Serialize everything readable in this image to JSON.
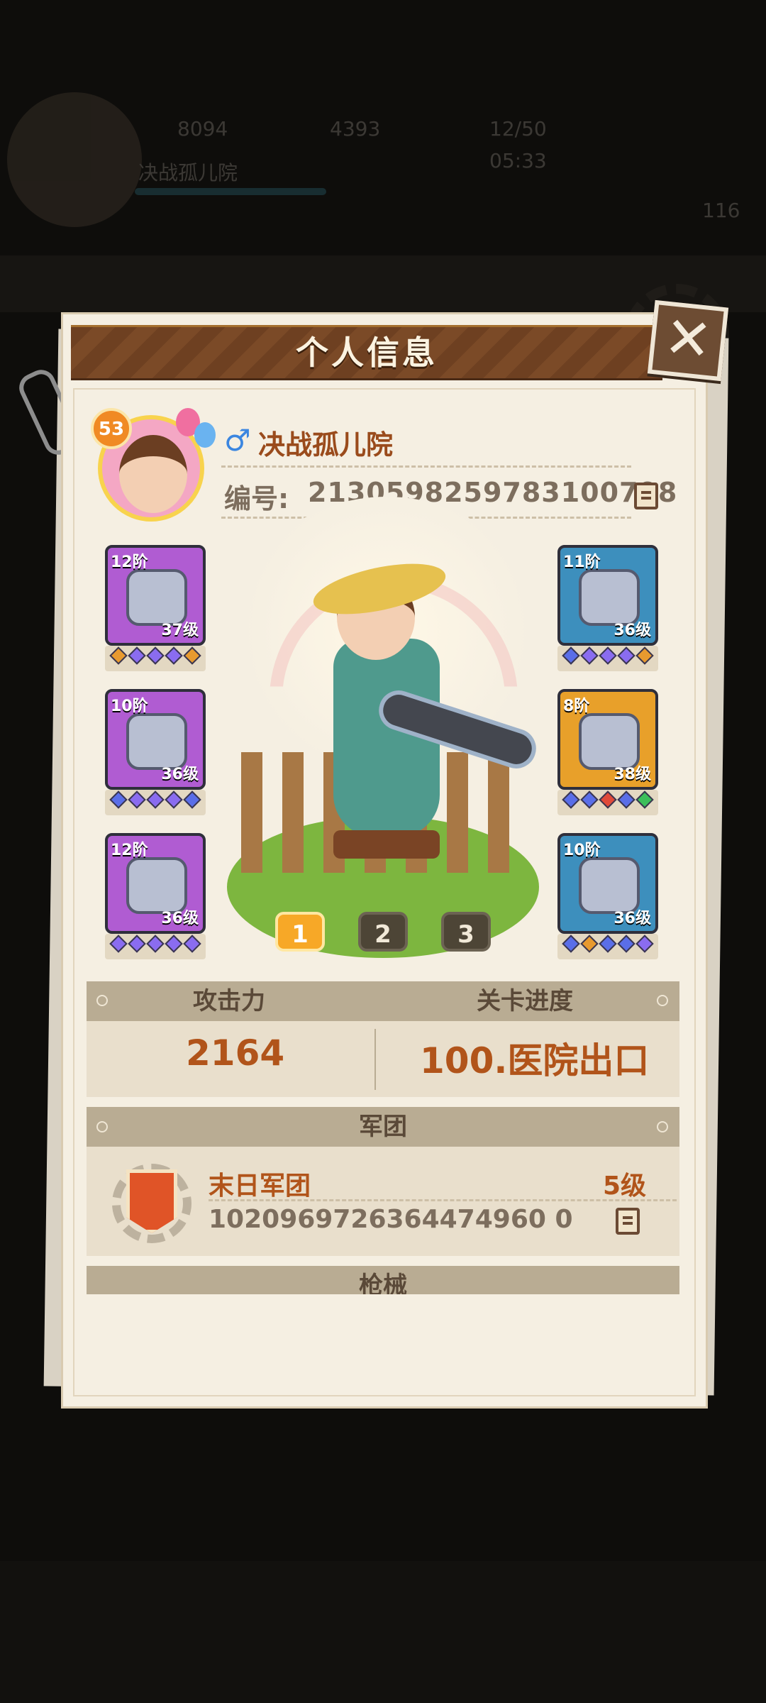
{
  "background_hud": {
    "stat1": "8094",
    "stat2": "4393",
    "stat3": "12/50",
    "timer": "05:33",
    "name": "决战孤儿院",
    "level": "116"
  },
  "dialog": {
    "title": "个人信息"
  },
  "player": {
    "level": "53",
    "gender_symbol": "♂",
    "name": "决战孤儿院",
    "id_label": "编号:",
    "id_value": "2130598259783100798"
  },
  "equipment_left": [
    {
      "tier": "12阶",
      "level": "37级",
      "rarity": "purple",
      "gems": [
        "#e89a2f",
        "#8a6cf0",
        "#8a6cf0",
        "#8a6cf0",
        "#e89a2f"
      ]
    },
    {
      "tier": "10阶",
      "level": "36级",
      "rarity": "purple",
      "gems": [
        "#5a6ee8",
        "#8a6cf0",
        "#8a6cf0",
        "#8a6cf0",
        "#5a6ee8"
      ]
    },
    {
      "tier": "12阶",
      "level": "36级",
      "rarity": "purple",
      "gems": [
        "#8a6cf0",
        "#8a6cf0",
        "#8a6cf0",
        "#8a6cf0",
        "#8a6cf0"
      ]
    }
  ],
  "equipment_right": [
    {
      "tier": "11阶",
      "level": "36级",
      "rarity": "blue",
      "gems": [
        "#5a6ee8",
        "#8a6cf0",
        "#8a6cf0",
        "#8a6cf0",
        "#e89a2f"
      ]
    },
    {
      "tier": "8阶",
      "level": "38级",
      "rarity": "orange",
      "gems": [
        "#5a6ee8",
        "#5a6ee8",
        "#e04a3a",
        "#5a6ee8",
        "#3cbf5a"
      ]
    },
    {
      "tier": "10阶",
      "level": "36级",
      "rarity": "blue",
      "gems": [
        "#5a6ee8",
        "#e89a2f",
        "#5a6ee8",
        "#5a6ee8",
        "#8a6cf0"
      ]
    }
  ],
  "loadout_pages": [
    "1",
    "2",
    "3"
  ],
  "active_page": "1",
  "stats": {
    "attack_label": "攻击力",
    "attack_value": "2164",
    "progress_label": "关卡进度",
    "progress_value": "100.医院出口"
  },
  "guild": {
    "section_label": "军团",
    "name": "末日军团",
    "level": "5级",
    "id": "1020969726364474960 0"
  },
  "guns": {
    "section_label": "枪械"
  },
  "colors": {
    "accent_orange": "#b1541a",
    "title_brown": "#6e4021",
    "panel_bg": "#f5efe2"
  }
}
